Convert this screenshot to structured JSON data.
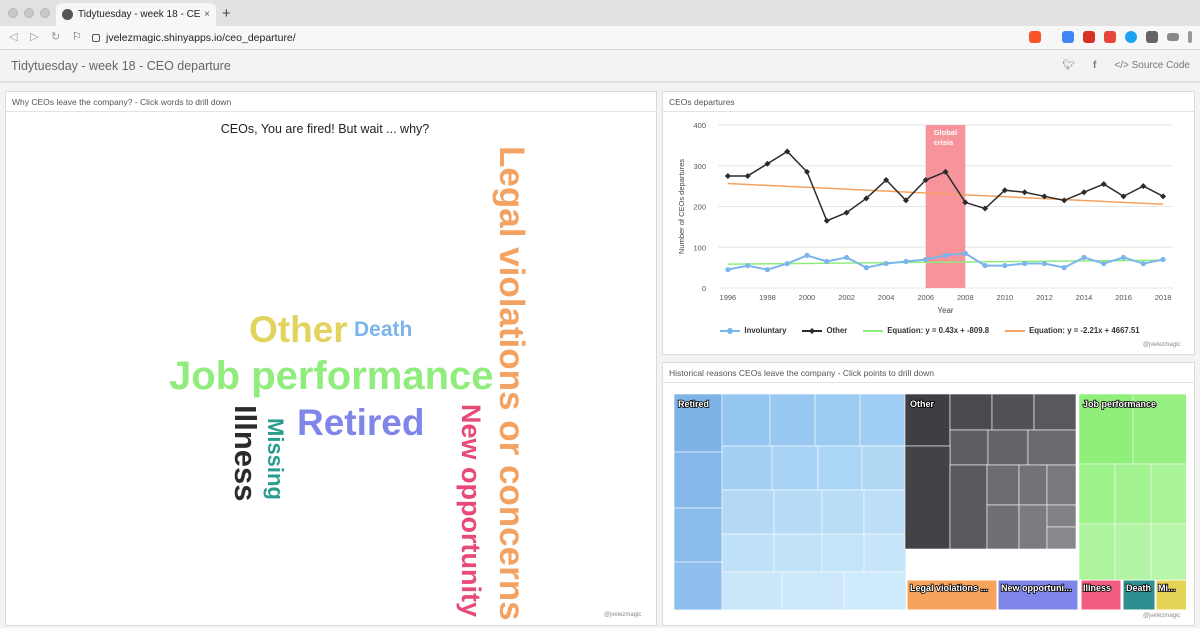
{
  "browser": {
    "tab_title": "Tidytuesday - week 18 - CEO d",
    "tab_close": "×",
    "new_tab": "+",
    "url": "jvelezmagic.shinyapps.io/ceo_departure/"
  },
  "app": {
    "title": "Tidytuesday - week 18 - CEO departure",
    "source_code": "Source Code",
    "source_icon": "</>"
  },
  "wordcloud_panel": {
    "title": "Why CEOs leave the company? - Click words to drill down",
    "heading": "CEOs, You are fired! But wait ... why?",
    "credit": "@jvelezmagic",
    "words": [
      {
        "text": "Legal violations or concerns",
        "color": "#f4a261"
      },
      {
        "text": "Other",
        "color": "#e2d35f"
      },
      {
        "text": "Death",
        "color": "#7cb5ec"
      },
      {
        "text": "Job performance",
        "color": "#90ed7d"
      },
      {
        "text": "Retired",
        "color": "#8085e9"
      },
      {
        "text": "Illness",
        "color": "#2b2b2b"
      },
      {
        "text": "Missing",
        "color": "#2a9d8f"
      },
      {
        "text": "New opportunity",
        "color": "#e84a78"
      }
    ]
  },
  "line_panel": {
    "title": "CEOs departures",
    "credit": "@jvelezmagic",
    "band_label_1": "Global",
    "band_label_2": "crisis"
  },
  "treemap_panel": {
    "title": "Historical reasons CEOs leave the company - Click points to drill down",
    "credit": "@jvelezmagic",
    "groups": [
      {
        "label": "Retired",
        "color": "#7cb5ec"
      },
      {
        "label": "Other",
        "color": "#434348"
      },
      {
        "label": "Job performance",
        "color": "#90ed7d"
      },
      {
        "label": "Legal violations ...",
        "color": "#f7a35c"
      },
      {
        "label": "New opportuni...",
        "color": "#8085e9"
      },
      {
        "label": "Illness",
        "color": "#f15c80"
      },
      {
        "label": "Death",
        "color": "#2b908f"
      },
      {
        "label": "Mi...",
        "color": "#e4d354"
      }
    ]
  },
  "chart_data": {
    "type": "line",
    "title": "",
    "xlabel": "Year",
    "ylabel": "Number of CEOs departures",
    "xlim": [
      1995.5,
      2018.5
    ],
    "ylim": [
      0,
      400
    ],
    "xticks": [
      1996,
      1998,
      2000,
      2002,
      2004,
      2006,
      2008,
      2010,
      2012,
      2014,
      2016,
      2018
    ],
    "yticks": [
      0,
      100,
      200,
      300,
      400
    ],
    "grid": true,
    "legend_position": "bottom",
    "annotations": [
      {
        "label": "Global crisis",
        "x_from": 2006,
        "x_to": 2008
      }
    ],
    "x": [
      1996,
      1997,
      1998,
      1999,
      2000,
      2001,
      2002,
      2003,
      2004,
      2005,
      2006,
      2007,
      2008,
      2009,
      2010,
      2011,
      2012,
      2013,
      2014,
      2015,
      2016,
      2017,
      2018
    ],
    "series": [
      {
        "name": "Involuntary",
        "color": "#7cb5ec",
        "values": [
          45,
          55,
          45,
          60,
          80,
          65,
          75,
          50,
          60,
          65,
          70,
          80,
          85,
          55,
          55,
          60,
          60,
          50,
          75,
          60,
          75,
          60,
          70
        ]
      },
      {
        "name": "Other",
        "color": "#2b2b2b",
        "values": [
          275,
          275,
          305,
          335,
          285,
          165,
          185,
          220,
          265,
          215,
          265,
          285,
          210,
          195,
          240,
          235,
          225,
          215,
          235,
          255,
          225,
          250,
          225
        ]
      },
      {
        "name": "Equation: y = 0.43x + -809.8",
        "color": "#90ed7d",
        "values": [
          58.48,
          68.37
        ]
      },
      {
        "name": "Equation: y = -2.21x + 4667.51",
        "color": "#f4a261",
        "values": [
          256.35,
          205.52
        ]
      }
    ]
  }
}
